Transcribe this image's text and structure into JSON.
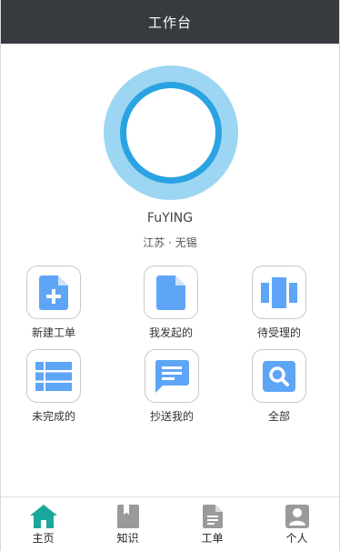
{
  "header": {
    "title": "工作台"
  },
  "profile": {
    "name": "FuYING",
    "location": "江苏 · 无锡"
  },
  "grid": [
    {
      "label": "新建工单",
      "icon": "new-document-icon"
    },
    {
      "label": "我发起的",
      "icon": "document-icon"
    },
    {
      "label": "待受理的",
      "icon": "carousel-icon"
    },
    {
      "label": "未完成的",
      "icon": "list-icon"
    },
    {
      "label": "抄送我的",
      "icon": "message-icon"
    },
    {
      "label": "全部",
      "icon": "search-icon"
    }
  ],
  "tabs": [
    {
      "label": "主页",
      "icon": "home-icon",
      "active": true
    },
    {
      "label": "知识",
      "icon": "bookmark-book-icon",
      "active": false
    },
    {
      "label": "工单",
      "icon": "ticket-document-icon",
      "active": false
    },
    {
      "label": "个人",
      "icon": "person-icon",
      "active": false
    }
  ],
  "colors": {
    "header_bg": "#373a3f",
    "icon_blue": "#5ea5f7",
    "active_tab": "#1aa89a",
    "inactive_tab": "#9a9a9a"
  }
}
